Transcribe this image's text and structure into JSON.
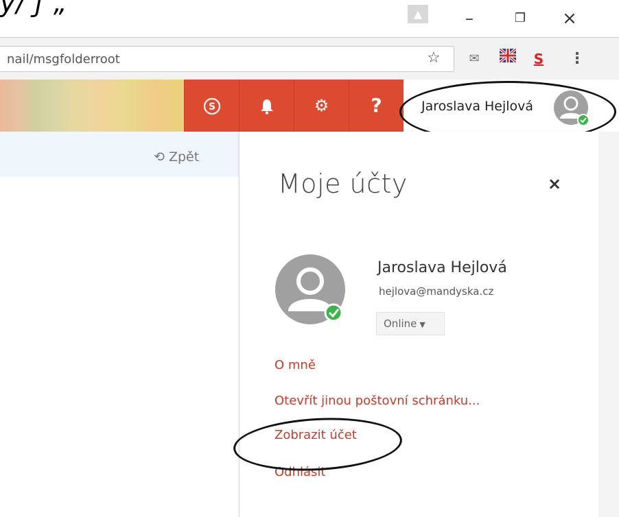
{
  "page_fragment_text": "y/ ƒ „",
  "window": {
    "profile_icon": "person-icon",
    "minimize_icon": "minimize-icon",
    "restore_icon": "restore-icon",
    "close_icon": "close-icon"
  },
  "browser": {
    "address": "nail/msgfolderroot",
    "star_icon": "star-icon",
    "extensions": [
      "mail-extension-icon",
      "uk-flag-icon",
      "s-extension-icon"
    ],
    "menu_icon": "more-vertical-icon"
  },
  "header": {
    "buttons": [
      "skype-icon",
      "bell-icon",
      "gear-icon",
      "help-icon"
    ],
    "help_label": "?",
    "user_name": "Jaroslava Hejlová",
    "accent_color": "#dc4b2f"
  },
  "content": {
    "back_label": "Zpět"
  },
  "account_panel": {
    "title": "Moje účty",
    "close_label": "×",
    "name": "Jaroslava Hejlová",
    "email": "hejlova@mandyska.cz",
    "status": "Online",
    "links": {
      "about": "O mně",
      "other_mailbox": "Otevřít jinou poštovní schránku...",
      "view_account": "Zobrazit účet",
      "sign_out": "Odhlásit"
    },
    "link_color": "#c43d2a",
    "status_dot_color": "#3bb54a"
  }
}
